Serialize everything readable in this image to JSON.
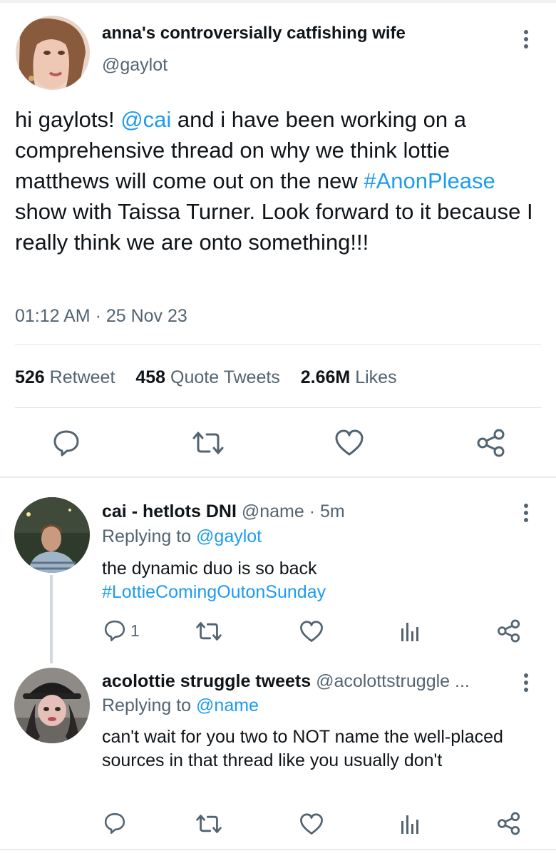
{
  "main_tweet": {
    "display_name": "anna's controversially catfishing wife",
    "handle": "@gaylot",
    "text": {
      "p1": "hi gaylots! ",
      "mention": "@cai",
      "p2": " and i have been working on a comprehensive thread on why we think lottie matthews will come out on the new ",
      "hashtag": "#AnonPlease",
      "p3": " show with Taissa Turner. Look forward to it because I really think we are onto something!!!"
    },
    "timestamp": "01:12 AM · 25 Nov 23",
    "stats": {
      "retweets_count": "526",
      "retweets_label": "Retweet",
      "quotes_count": "458",
      "quotes_label": "Quote Tweets",
      "likes_count": "2.66M",
      "likes_label": "Likes"
    }
  },
  "replies": [
    {
      "display_name": "cai - hetlots DNI",
      "handle": "@name",
      "time": "· 5m",
      "replying_label": "Replying to ",
      "replying_to": "@gaylot",
      "text": "the dynamic duo is so back",
      "hashtag": "#LottieComingOutonSunday",
      "reply_count": "1"
    },
    {
      "display_name": "acolottie struggle tweets",
      "handle": "@acolottstruggle ...",
      "replying_label": "Replying to ",
      "replying_to": "@name",
      "text": "can't wait for you two to NOT name the well-placed sources in that thread like you usually don't"
    }
  ],
  "icons": {
    "reply": "reply-icon",
    "retweet": "retweet-icon",
    "like": "like-icon",
    "share": "share-icon",
    "analytics": "analytics-icon",
    "more": "more-icon"
  },
  "colors": {
    "link": "#1d9bf0",
    "text": "#0f1419",
    "muted": "#536471",
    "divider": "#e1e5e8"
  }
}
